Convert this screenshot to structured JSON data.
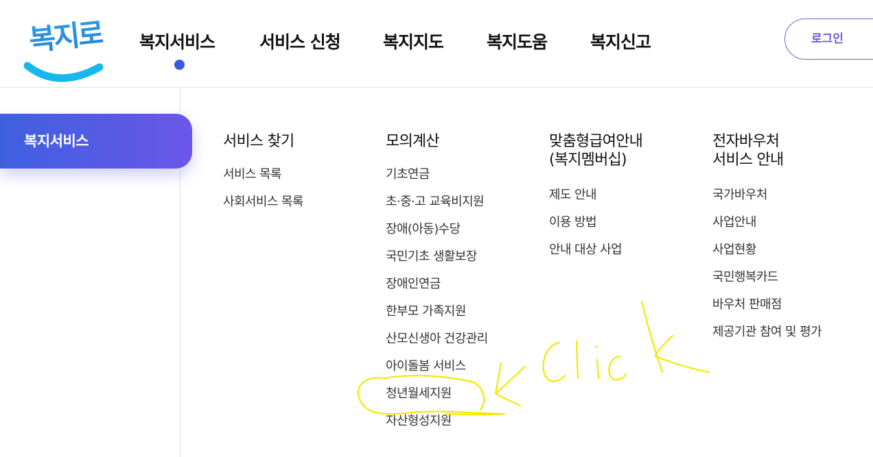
{
  "logo": {
    "text": "복지로"
  },
  "gnb": {
    "items": [
      "복지서비스",
      "서비스 신청",
      "복지지도",
      "복지도움",
      "복지신고"
    ],
    "login_label": "로그인"
  },
  "side": {
    "active_label": "복지서비스"
  },
  "menu": {
    "columns": [
      {
        "title": "서비스 찾기",
        "items": [
          "서비스 목록",
          "사회서비스 목록"
        ]
      },
      {
        "title": "모의계산",
        "items": [
          "기초연금",
          "초·중·고 교육비지원",
          "장애(아동)수당",
          "국민기초 생활보장",
          "장애인연금",
          "한부모 가족지원",
          "산모신생아 건강관리",
          "아이돌봄 서비스",
          "청년월세지원",
          "자산형성지원"
        ]
      },
      {
        "title_line1": "맞춤형급여안내",
        "title_line2": "(복지멤버십)",
        "items": [
          "제도 안내",
          "이용 방법",
          "안내 대상 사업"
        ]
      },
      {
        "title_line1": "전자바우처",
        "title_line2": "서비스 안내",
        "items": [
          "국가바우처",
          "사업안내",
          "사업현황",
          "국민행복카드",
          "바우처 판매점",
          "제공기관 참여 및 평가"
        ]
      }
    ]
  },
  "annotation": {
    "text": "click",
    "color": "#f5e800"
  },
  "colors": {
    "accent": "#3a5bd9",
    "gradient_end": "#6b56ea",
    "logo_blue": "#18b8ee"
  }
}
